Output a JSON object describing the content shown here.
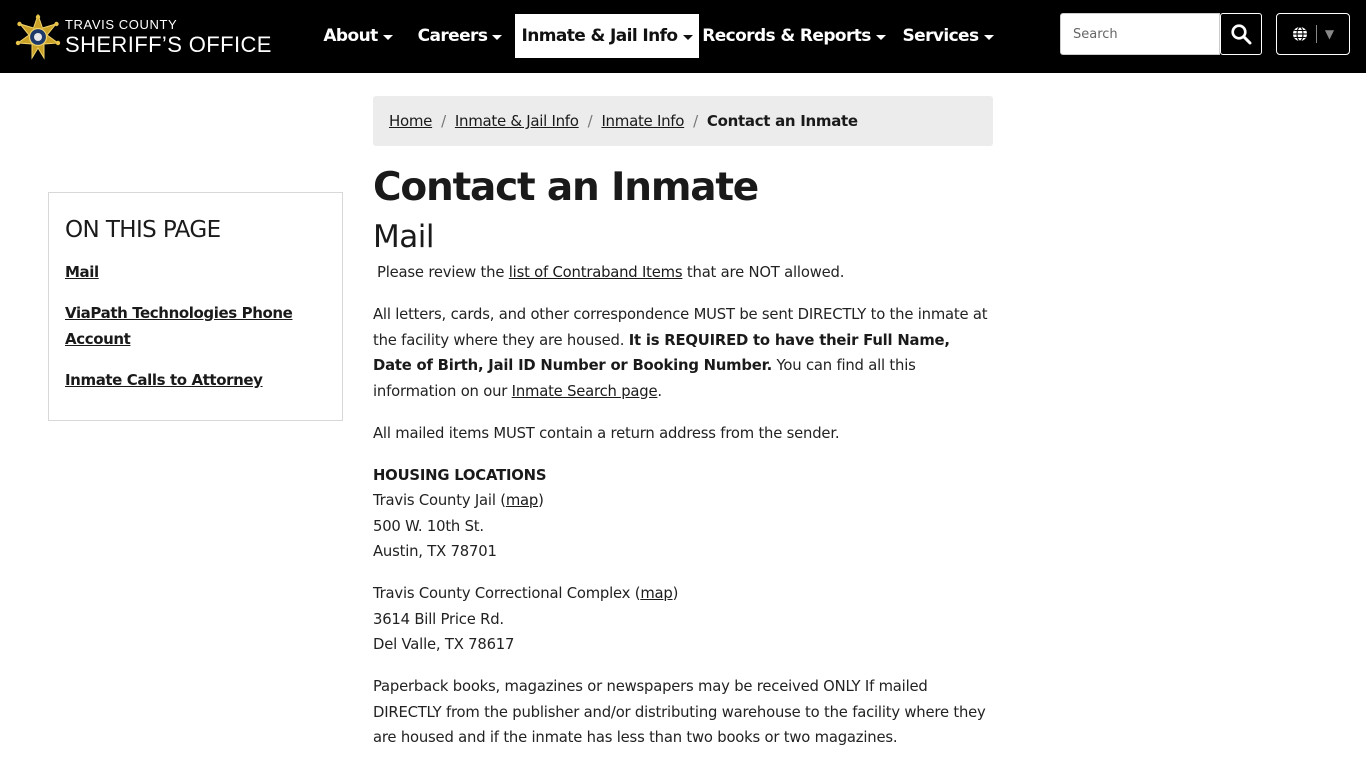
{
  "header": {
    "logo": {
      "top_line": "TRAVIS COUNTY",
      "bottom_line": "SHERIFF’S OFFICE"
    },
    "nav": [
      {
        "label": "About"
      },
      {
        "label": "Careers"
      },
      {
        "label": "Inmate & Jail Info",
        "active": true
      },
      {
        "label": "Records & Reports"
      },
      {
        "label": "Services"
      }
    ],
    "search": {
      "placeholder": "Search"
    },
    "colors": {
      "bar": "#000000",
      "active_tab": "#ffffff",
      "logo_gold": "#c9a227"
    }
  },
  "breadcrumb": {
    "items": [
      "Home",
      "Inmate & Jail Info",
      "Inmate Info"
    ],
    "current": "Contact an Inmate"
  },
  "sidebar": {
    "title": "ON THIS PAGE",
    "links": [
      "Mail",
      "ViaPath Technologies Phone Account",
      "Inmate Calls to Attorney"
    ]
  },
  "main": {
    "title": "Contact an Inmate",
    "section": "Mail",
    "p1": {
      "pre": "Please review the ",
      "link": "list of Contraband Items",
      "post": " that are NOT allowed."
    },
    "p2": {
      "pre": "All letters, cards, and other correspondence MUST be sent DIRECTLY to the inmate at the facility where they are housed. ",
      "bold": "It is REQUIRED to have their Full Name, Date of Birth, Jail ID Number or Booking Number.",
      "mid": " You can find all this information on our ",
      "link": "Inmate Search page",
      "post": "."
    },
    "p3": "All mailed items MUST contain a return address from the sender.",
    "housing": {
      "heading": "HOUSING LOCATIONS",
      "jail": {
        "name": "Travis County Jail (",
        "map": "map",
        "close": ")",
        "street": "500 W. 10th St.",
        "city": "Austin, TX 78701"
      },
      "complex": {
        "name": "Travis County Correctional Complex (",
        "map": "map",
        "close": ")",
        "street": "3614 Bill Price Rd.",
        "city": "Del Valle, TX 78617"
      }
    },
    "p5": "Paperback books, magazines or newspapers may be received ONLY If mailed DIRECTLY from the publisher and/or distributing warehouse to the facility where they are housed and if the inmate has less than two books or two magazines."
  }
}
